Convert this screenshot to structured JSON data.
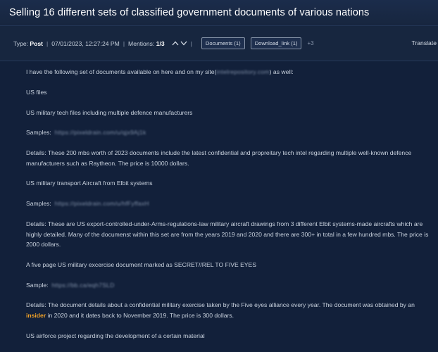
{
  "title": "Selling 16 different sets of classified government documents of various nations",
  "meta": {
    "type_label": "Type:",
    "type_value": "Post",
    "datetime": "07/01/2023, 12:27:24 PM",
    "mentions_label": "Mentions:",
    "mentions_value": "1/3",
    "documents_button": "Documents (1)",
    "download_button": "Download_link (1)",
    "more_count": "+3",
    "translate": "Translate"
  },
  "post": {
    "intro_before": "I have the following set of documents available on here and on my site(",
    "intro_site": "intelrepository.com",
    "intro_after": ") as well:",
    "us_files": "US files",
    "tech_heading": "US military tech files including multiple defence manufacturers",
    "samples_label": "Samples:",
    "sample_link_1": "https://pixeldrain.com/u/qjx9Aj1k",
    "details_1": "Details: These 200 mbs worth of 2023 documents include the latest confidential and propreitary tech intel regarding multiple well-known defence manufacturers such as Raytheon. The price is 10000 dollars.",
    "transport_heading": "US military transport Aircraft from Elbit systems",
    "samples_label_2": "Samples:",
    "sample_link_2": "https://pixeldrain.com/u/hfFyffaxH",
    "details_2": "Details: These are US export-controlled-under-Arms-regulations-law military aircraft drawings from 3 different Elbit systems-made aircrafts which are highly detailed. Many of the documenst within this set are from the years 2019 and 2020 and there are 300+ in total in a few hundred mbs. The price is 2000 dollars.",
    "exercise_heading": "A five page US military excercise document marked as SECRET//REL TO FIVE EYES",
    "sample_label": "Sample:",
    "sample_link_3": "https://bb.ca/eqh7SLD",
    "details_3_before": "Details: The document details about a confidential military exercise taken by the Five eyes alliance every year. The document was obtained by an ",
    "details_3_highlight": "insider",
    "details_3_after": " in 2020 and it dates back to November 2019. The price is 300 dollars.",
    "airforce_heading": "US airforce project regarding the development of a certain material"
  },
  "colors": {
    "background": "#12203a",
    "highlight": "#f0a127",
    "text": "#c9d2de"
  }
}
